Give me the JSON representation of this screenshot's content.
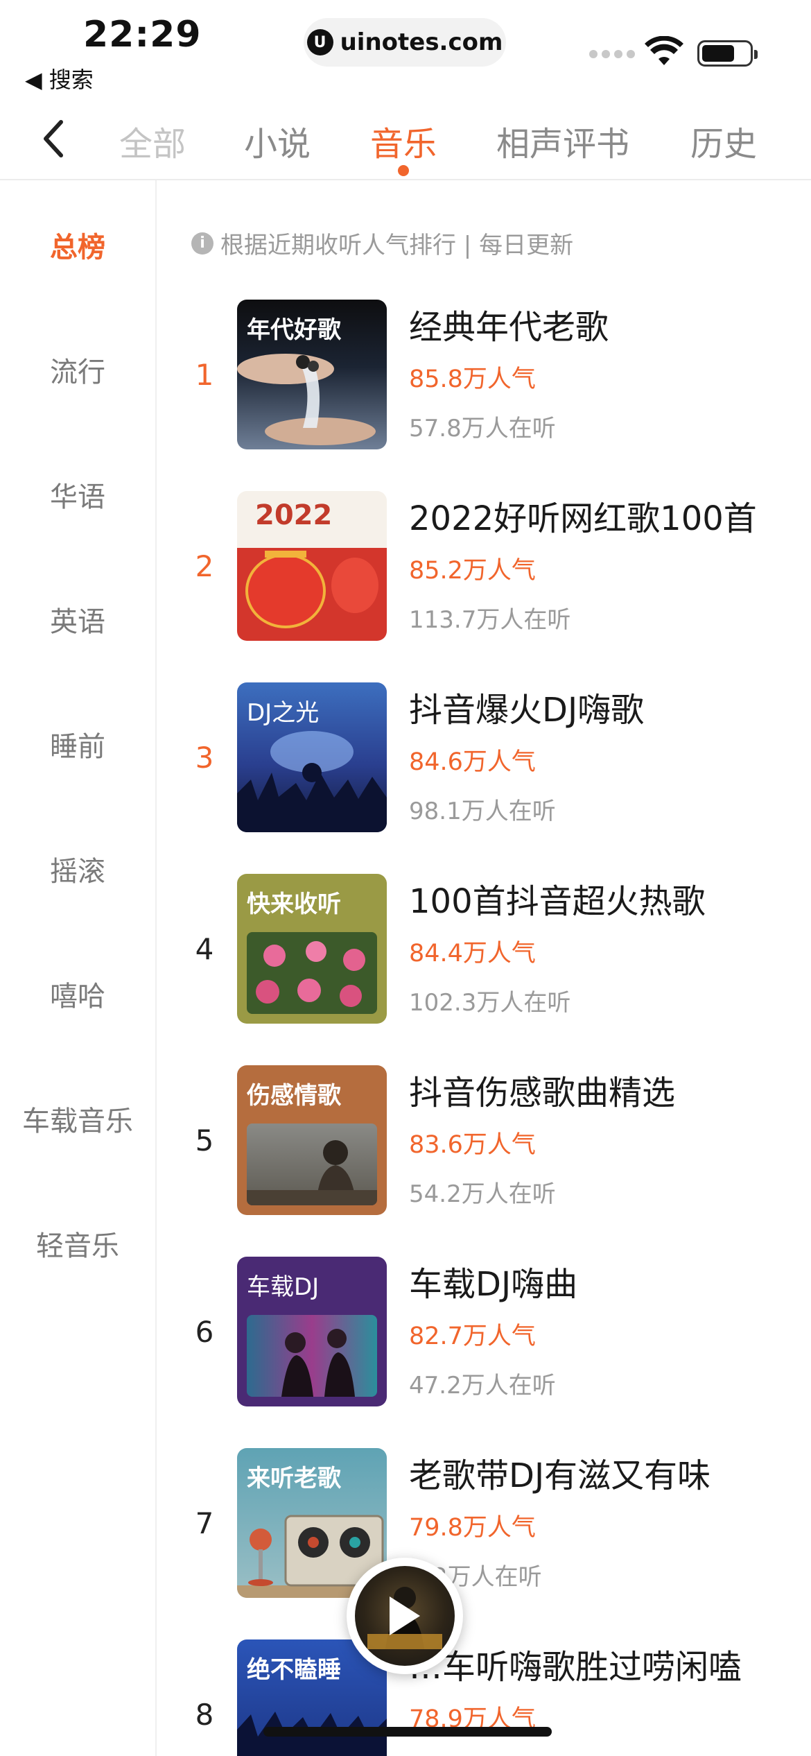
{
  "status_bar": {
    "time": "22:29",
    "back_app": "◀ 搜索",
    "url": "uinotes.com",
    "url_logo": "U"
  },
  "nav": {
    "tabs": [
      {
        "label": "全部"
      },
      {
        "label": "小说"
      },
      {
        "label": "音乐"
      },
      {
        "label": "相声评书"
      },
      {
        "label": "历史"
      }
    ],
    "active_tab": "音乐"
  },
  "sidebar": {
    "items": [
      {
        "label": "总榜"
      },
      {
        "label": "流行"
      },
      {
        "label": "华语"
      },
      {
        "label": "英语"
      },
      {
        "label": "睡前"
      },
      {
        "label": "摇滚"
      },
      {
        "label": "嘻哈"
      },
      {
        "label": "车载音乐"
      },
      {
        "label": "轻音乐"
      }
    ],
    "active": "总榜"
  },
  "notice": {
    "icon": "info-icon",
    "text": "根据近期收听人气排行 | 每日更新"
  },
  "ranking": [
    {
      "rank": "1",
      "cover_label": "年代好歌",
      "title": "经典年代老歌",
      "popularity": "85.8万人气",
      "listening": "57.8万人在听"
    },
    {
      "rank": "2",
      "cover_label": "2022",
      "title": "2022好听网红歌100首",
      "popularity": "85.2万人气",
      "listening": "113.7万人在听"
    },
    {
      "rank": "3",
      "cover_label": "DJ之光",
      "title": "抖音爆火DJ嗨歌",
      "popularity": "84.6万人气",
      "listening": "98.1万人在听"
    },
    {
      "rank": "4",
      "cover_label": "快来收听",
      "title": "100首抖音超火热歌",
      "popularity": "84.4万人气",
      "listening": "102.3万人在听"
    },
    {
      "rank": "5",
      "cover_label": "伤感情歌",
      "title": "抖音伤感歌曲精选",
      "popularity": "83.6万人气",
      "listening": "54.2万人在听"
    },
    {
      "rank": "6",
      "cover_label": "车载DJ",
      "title": "车载DJ嗨曲",
      "popularity": "82.7万人气",
      "listening": "47.2万人在听"
    },
    {
      "rank": "7",
      "cover_label": "来听老歌",
      "title": "老歌带DJ有滋又有味",
      "popularity": "79.8万人气",
      "listening": "…2万人在听"
    },
    {
      "rank": "8",
      "cover_label": "绝不瞌睡",
      "title": "…车听嗨歌胜过唠闲嗑",
      "popularity": "78.9万人气",
      "listening": ""
    }
  ],
  "colors": {
    "accent": "#f1652c",
    "muted": "#9a9a9a"
  }
}
